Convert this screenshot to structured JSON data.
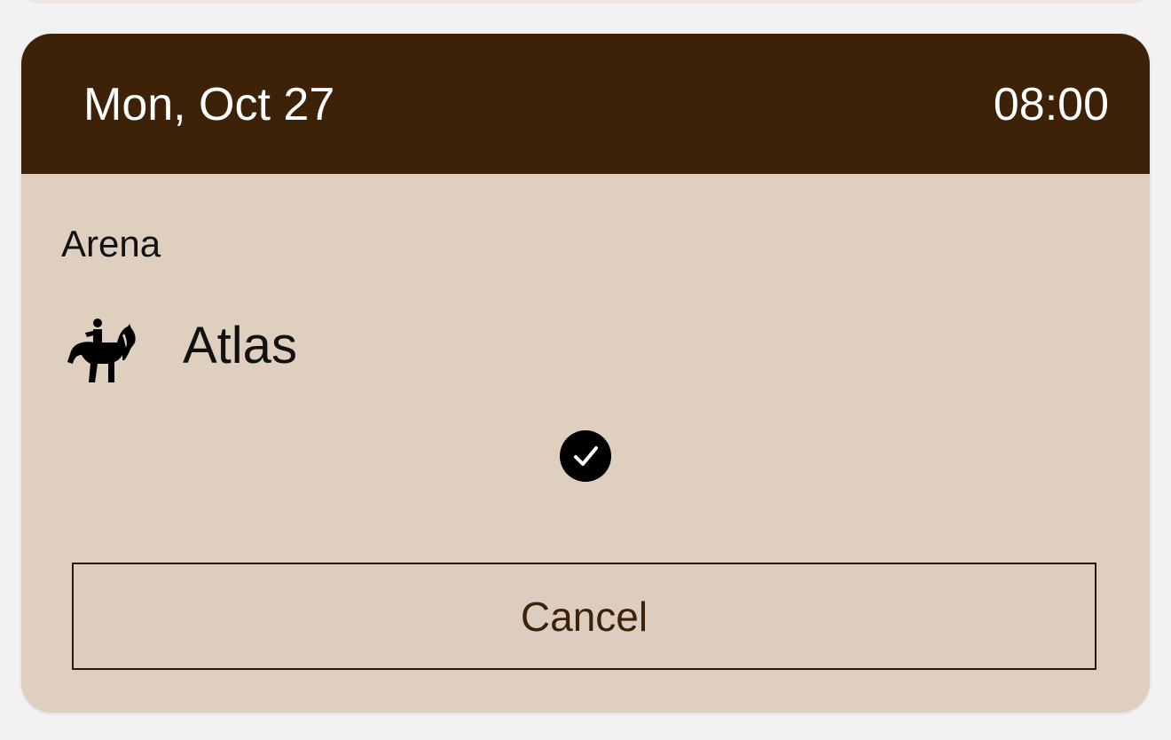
{
  "booking": {
    "date": "Mon, Oct 27",
    "time": "08:00",
    "location": "Arena",
    "horse": "Atlas",
    "rider_icon": "equestrian-icon",
    "status_icon": "check-circle-icon",
    "cancel_label": "Cancel"
  },
  "colors": {
    "header_bg": "#3d2208",
    "card_bg": "#dfcfbf",
    "page_bg": "#f2f2f2",
    "cancel_text": "#3d2208"
  }
}
